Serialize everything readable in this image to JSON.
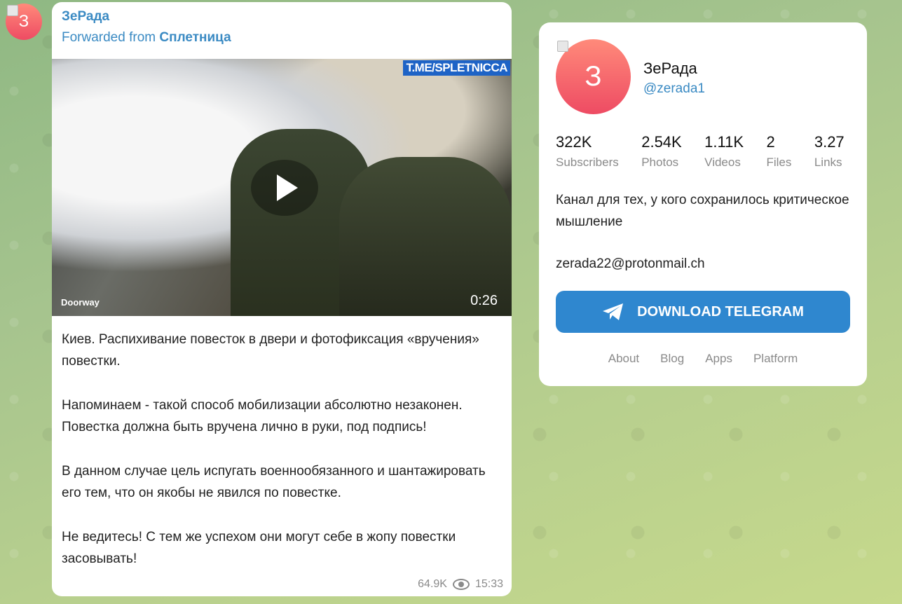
{
  "message": {
    "channel_name": "ЗеРада",
    "forwarded_prefix": "Forwarded from",
    "forwarded_from": "Сплетница",
    "avatar_letter": "З",
    "video": {
      "watermark": "T.ME/SPLETNICCA",
      "caption_label": "Doorway",
      "duration": "0:26"
    },
    "text_paragraphs": [
      "Киев. Распихивание повесток в двери и фотофиксация «вручения» повестки.",
      "Напоминаем - такой способ мобилизации абсолютно незаконен. Повестка должна быть вручена лично в руки, под подпись!",
      "В данном случае цель испугать военнообязанного и шантажировать его тем, что он якобы не явился по повестке.",
      "Не ведитесь! С тем же успехом они могут себе в жопу повестки засовывать!"
    ],
    "views": "64.9K",
    "time": "15:33"
  },
  "card": {
    "avatar_letter": "З",
    "title": "ЗеРада",
    "handle": "@zerada1",
    "stats": [
      {
        "value": "322K",
        "label": "Subscribers"
      },
      {
        "value": "2.54K",
        "label": "Photos"
      },
      {
        "value": "1.11K",
        "label": "Videos"
      },
      {
        "value": "2",
        "label": "Files"
      },
      {
        "value": "3.27",
        "label": "Links"
      }
    ],
    "description": "Канал для тех, у кого сохранилось критическое мышление",
    "email": "zerada22@protonmail.ch",
    "download_label": "DOWNLOAD TELEGRAM",
    "footer_links": [
      "About",
      "Blog",
      "Apps",
      "Platform"
    ]
  },
  "colors": {
    "accent": "#3a8ac3",
    "button": "#2f87cf",
    "avatar": "#ee4b63"
  }
}
